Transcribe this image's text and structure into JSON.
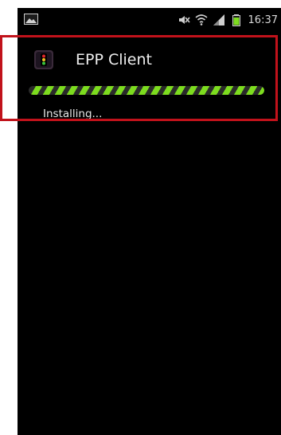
{
  "status_bar": {
    "time": "16:37",
    "left_icon": "gallery-icon",
    "right_icons": [
      "mute-icon",
      "wifi-icon",
      "signal-icon",
      "battery-icon"
    ]
  },
  "notification": {
    "app_name": "EPP Client",
    "app_icon": "traffic-light-icon",
    "status_text": "Installing...",
    "progress": 1.0,
    "progress_style": "indeterminate-striped",
    "progress_color": "#7ddc1f"
  },
  "colors": {
    "background": "#000000",
    "highlight": "#c1121b"
  }
}
